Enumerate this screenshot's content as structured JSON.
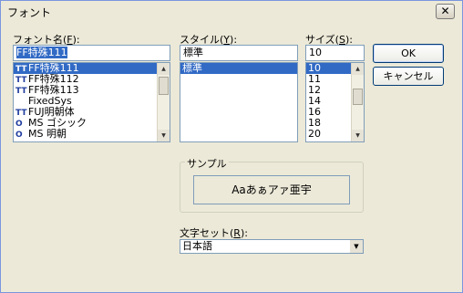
{
  "window": {
    "title": "フォント",
    "close_label": "✕"
  },
  "font": {
    "label_text": "フォント名(",
    "label_key": "F",
    "label_tail": "):",
    "value": "FF特殊111",
    "items": [
      {
        "icon": "TT",
        "name": "FF特殊111",
        "selected": true
      },
      {
        "icon": "TT",
        "name": "FF特殊112",
        "selected": false
      },
      {
        "icon": "TT",
        "name": "FF特殊113",
        "selected": false
      },
      {
        "icon": "",
        "name": "FixedSys",
        "selected": false
      },
      {
        "icon": "TT",
        "name": "FUJ明朝体",
        "selected": false
      },
      {
        "icon": "O",
        "name": "MS ゴシック",
        "selected": false
      },
      {
        "icon": "O",
        "name": "MS 明朝",
        "selected": false
      }
    ]
  },
  "style": {
    "label_text": "スタイル(",
    "label_key": "Y",
    "label_tail": "):",
    "value": "標準",
    "items": [
      {
        "name": "標準",
        "selected": true
      }
    ]
  },
  "size": {
    "label_text": "サイズ(",
    "label_key": "S",
    "label_tail": "):",
    "value": "10",
    "items": [
      {
        "name": "10",
        "selected": true
      },
      {
        "name": "11",
        "selected": false
      },
      {
        "name": "12",
        "selected": false
      },
      {
        "name": "14",
        "selected": false
      },
      {
        "name": "16",
        "selected": false
      },
      {
        "name": "18",
        "selected": false
      },
      {
        "name": "20",
        "selected": false
      }
    ]
  },
  "buttons": {
    "ok": "OK",
    "cancel": "キャンセル"
  },
  "sample": {
    "label": "サンプル",
    "text": "Aaあぁアァ亜宇"
  },
  "charset": {
    "label_text": "文字セット(",
    "label_key": "R",
    "label_tail": "):",
    "value": "日本語"
  }
}
